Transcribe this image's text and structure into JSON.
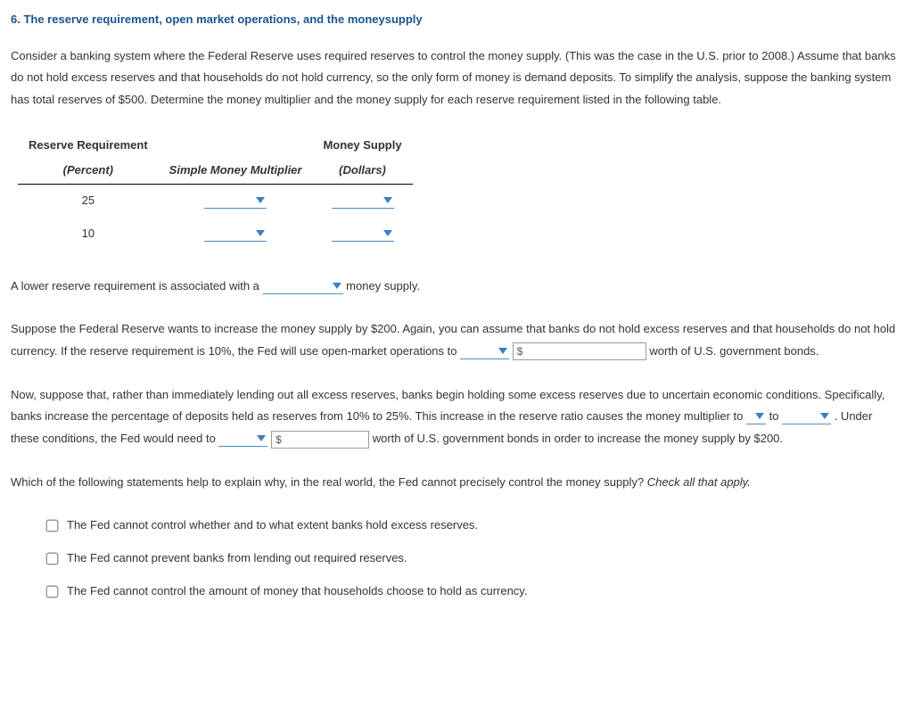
{
  "title": "6. The reserve requirement, open market operations, and the moneysupply",
  "intro": "Consider a banking system where the Federal Reserve uses required reserves to control the money supply. (This was the case in the U.S. prior to 2008.) Assume that banks do not hold excess reserves and that households do not hold currency, so the only form of money is demand deposits. To simplify the analysis, suppose the banking system has total reserves of $500. Determine the money multiplier and the money supply for each reserve requirement listed in the following table.",
  "table": {
    "col1_header": "Reserve Requirement",
    "col1_sub": "(Percent)",
    "col2_header": "Simple Money Multiplier",
    "col3_header": "Money Supply",
    "col3_sub": "(Dollars)",
    "rows": [
      {
        "percent": "25"
      },
      {
        "percent": "10"
      }
    ]
  },
  "sentence1": {
    "a": "A lower reserve requirement is associated with a",
    "b": "money supply."
  },
  "sentence2": {
    "a": "Suppose the Federal Reserve wants to increase the money supply by $200. Again, you can assume that banks do not hold excess reserves and that households do not hold currency. If the reserve requirement is 10%, the Fed will use open-market operations to",
    "b": "worth of U.S. government bonds.",
    "dollar_placeholder": "$"
  },
  "sentence3": {
    "a": "Now, suppose that, rather than immediately lending out all excess reserves, banks begin holding some excess reserves due to uncertain economic conditions. Specifically, banks increase the percentage of deposits held as reserves from 10% to 25%. This increase in the reserve ratio causes the money multiplier to",
    "b": "to",
    "c": ". Under these conditions, the Fed would need to",
    "d": "worth of U.S. government bonds in order to increase the money supply by $200.",
    "dollar_placeholder": "$"
  },
  "sentence4": {
    "a": "Which of the following statements help to explain why, in the real world, the Fed cannot precisely control the money supply?",
    "b": "Check all that apply."
  },
  "checks": [
    "The Fed cannot control whether and to what extent banks hold excess reserves.",
    "The Fed cannot prevent banks from lending out required reserves.",
    "The Fed cannot control the amount of money that households choose to hold as currency."
  ]
}
